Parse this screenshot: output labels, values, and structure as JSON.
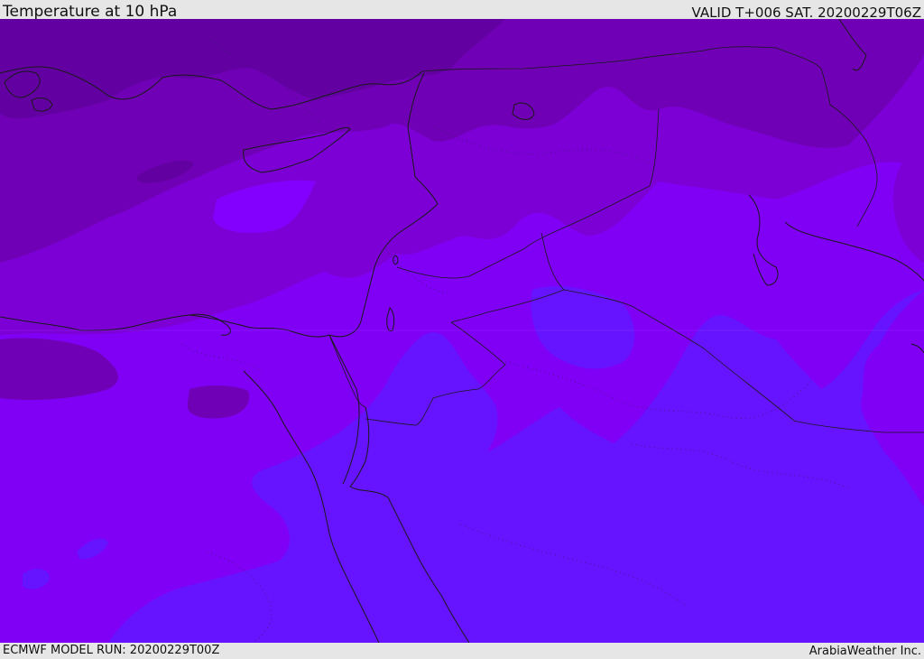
{
  "header": {
    "title": "Temperature at 10 hPa",
    "valid_time": "VALID T+006 SAT. 20200229T06Z"
  },
  "footer": {
    "model_run": "ECMWF MODEL RUN: 20200229T00Z",
    "credit": "ArabiaWeather Inc."
  },
  "map": {
    "colors": {
      "darkest": "#6300a2",
      "dark": "#7000b5",
      "mid": "#7c00d6",
      "violet": "#8000f6",
      "bright": "#8300ff",
      "blue_violet": "#6614ff",
      "lines": "#1a1a1a"
    }
  }
}
